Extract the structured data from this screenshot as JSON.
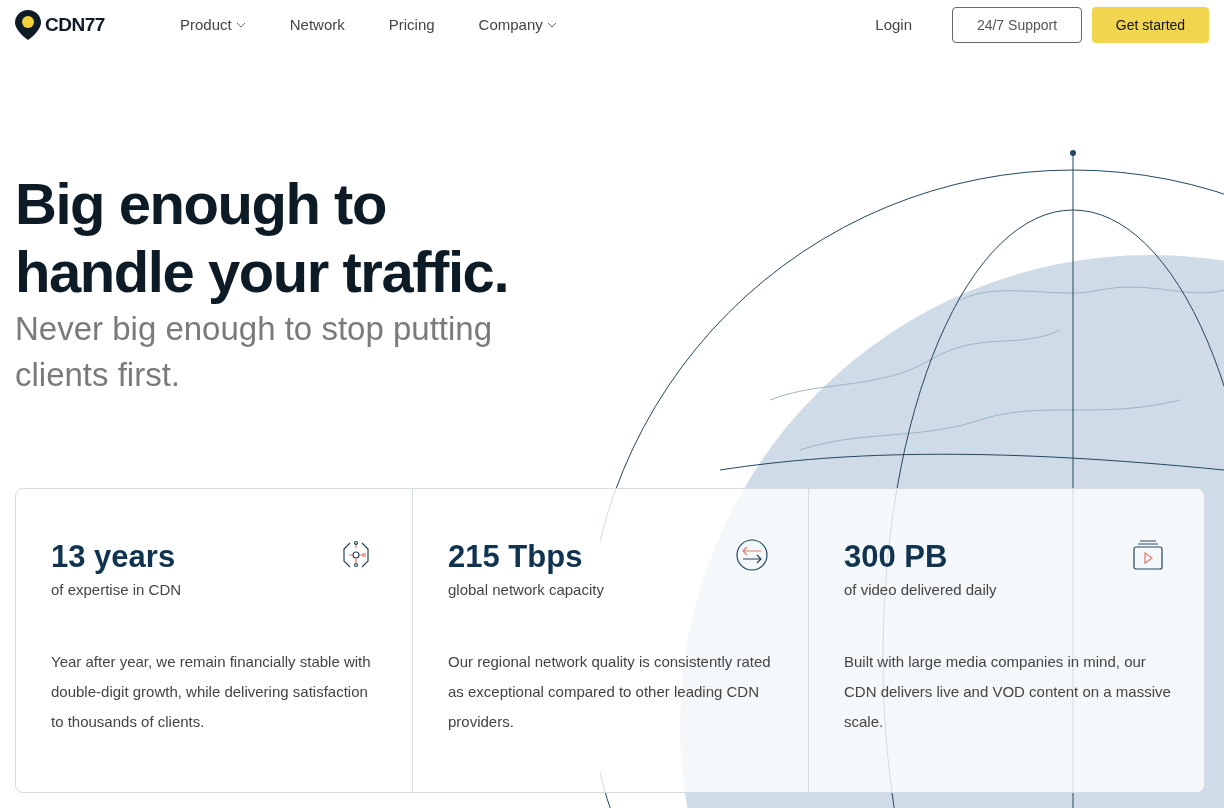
{
  "header": {
    "logo": "CDN77",
    "nav": [
      {
        "label": "Product",
        "dropdown": true
      },
      {
        "label": "Network",
        "dropdown": false
      },
      {
        "label": "Pricing",
        "dropdown": false
      },
      {
        "label": "Company",
        "dropdown": true
      }
    ],
    "login": "Login",
    "support_button": "24/7 Support",
    "cta_button": "Get started"
  },
  "hero": {
    "title": "Big enough to handle your traffic.",
    "subtitle": "Never big enough to stop putting clients first."
  },
  "stats": [
    {
      "kind": "circuit",
      "value": "13 years",
      "caption": "of expertise in CDN",
      "text": "Year after year, we remain financially stable with double-digit growth, while delivering satisfaction to thousands of clients."
    },
    {
      "kind": "arrows",
      "value": "215 Tbps",
      "caption": "global network capacity",
      "text": "Our regional network quality is consistently rated as exceptional compared to other leading CDN providers."
    },
    {
      "kind": "video",
      "value": "300 PB",
      "caption": "of video delivered daily",
      "text": "Built with large media companies in mind, our CDN delivers live and VOD content on a massive scale."
    }
  ]
}
